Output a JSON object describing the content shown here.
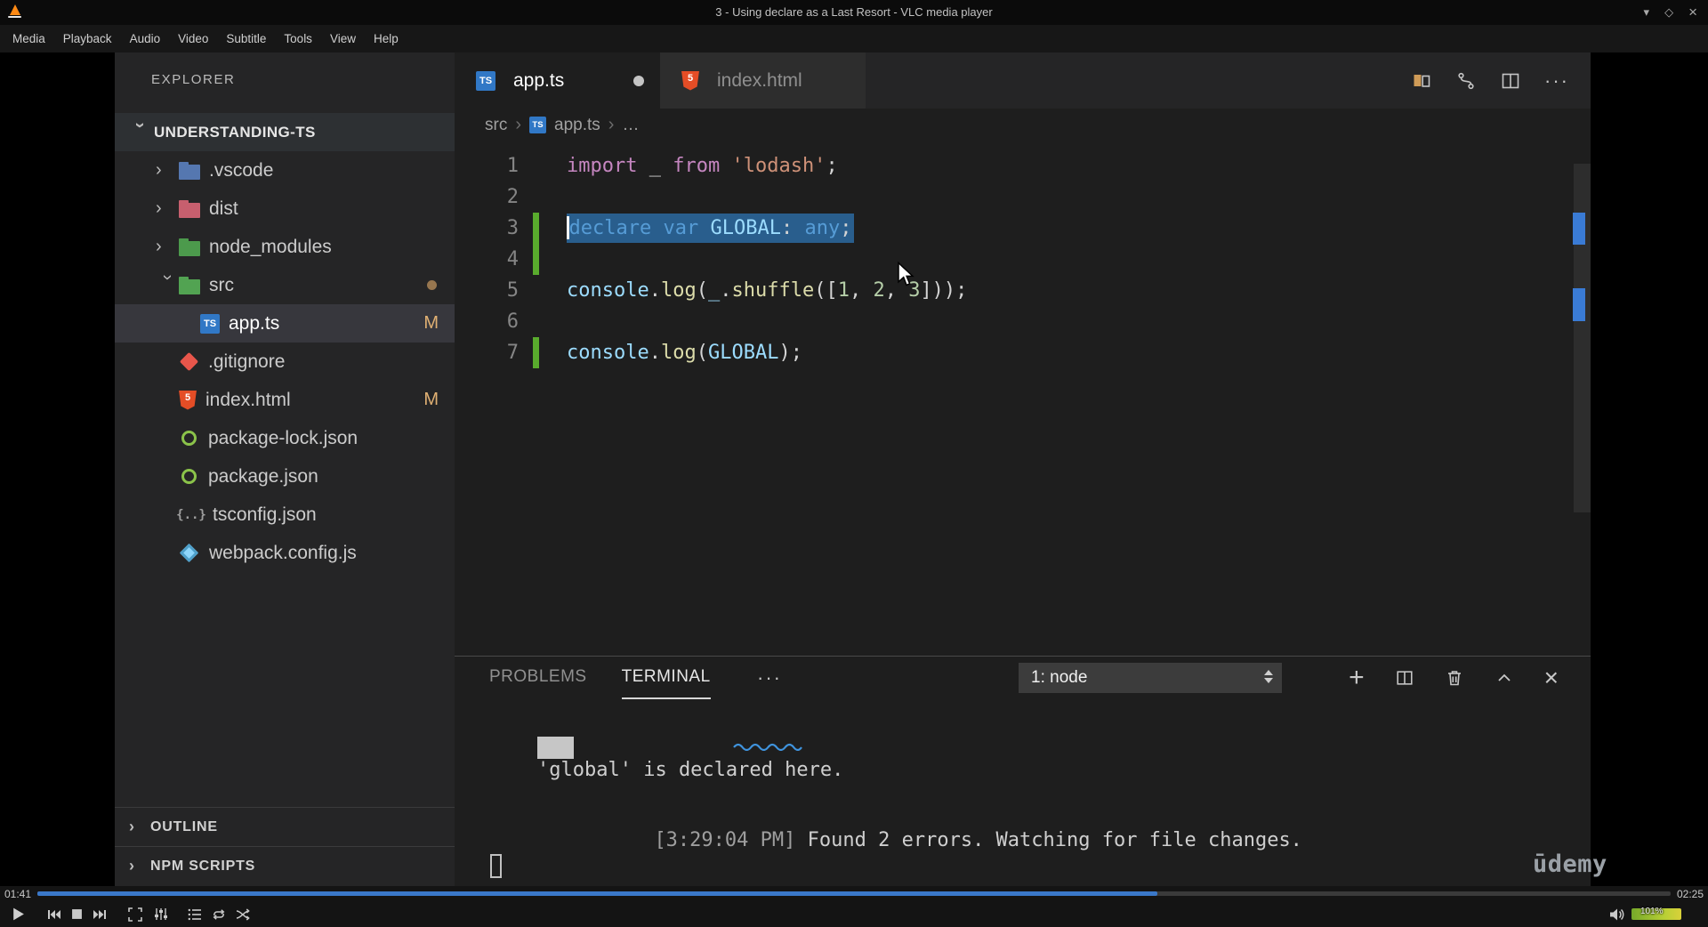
{
  "window": {
    "title": "3 - Using declare as a Last Resort - VLC media player",
    "menu_items": [
      "Media",
      "Playback",
      "Audio",
      "Video",
      "Subtitle",
      "Tools",
      "View",
      "Help"
    ]
  },
  "icons": {
    "minimize": "▾",
    "maximize": "◇",
    "close": "×",
    "chevron": "›",
    "ellipsis": "···",
    "plus": "+",
    "ts_badge": "TS",
    "html_badge": "5",
    "braces_glyph": "{..}"
  },
  "player": {
    "time_elapsed": "01:41",
    "time_total": "02:25",
    "progress_percent": 68.6,
    "volume_label": "101%"
  },
  "editor": {
    "explorer_title": "EXPLORER",
    "root_folder": "UNDERSTANDING-TS",
    "files": [
      {
        "label": ".vscode",
        "kind": "folder",
        "color": "#5577b0"
      },
      {
        "label": "dist",
        "kind": "folder",
        "color": "#c75f6e"
      },
      {
        "label": "node_modules",
        "kind": "folder",
        "color": "#4c9a4c"
      },
      {
        "label": "src",
        "kind": "folder",
        "color": "#52a352",
        "expand": true,
        "dot": true
      },
      {
        "label": "app.ts",
        "kind": "ts",
        "child": true,
        "selected": true,
        "badge": "M"
      },
      {
        "label": ".gitignore",
        "kind": "git"
      },
      {
        "label": "index.html",
        "kind": "html",
        "badge": "M"
      },
      {
        "label": "package-lock.json",
        "kind": "json"
      },
      {
        "label": "package.json",
        "kind": "json"
      },
      {
        "label": "tsconfig.json",
        "kind": "braces"
      },
      {
        "label": "webpack.config.js",
        "kind": "webpack"
      }
    ],
    "sections": [
      "OUTLINE",
      "NPM SCRIPTS"
    ],
    "tabs": [
      {
        "label": "app.ts",
        "icon": "ts",
        "active": true,
        "dirty": true
      },
      {
        "label": "index.html",
        "icon": "html",
        "active": false
      }
    ],
    "breadcrumb": [
      "src",
      "app.ts",
      "…"
    ],
    "code_lines": [
      {
        "n": "1",
        "tokens": [
          [
            "kw",
            "import"
          ],
          [
            "pl",
            " _ "
          ],
          [
            "kw",
            "from"
          ],
          [
            "pl",
            " "
          ],
          [
            "str",
            "'lodash'"
          ],
          [
            "pl",
            ";"
          ]
        ]
      },
      {
        "n": "2",
        "tokens": []
      },
      {
        "n": "3",
        "sel": true,
        "gutter": true,
        "tokens": [
          [
            "blue",
            "declare"
          ],
          [
            "pl",
            " "
          ],
          [
            "blue",
            "var"
          ],
          [
            "pl",
            " "
          ],
          [
            "id",
            "GLOBAL"
          ],
          [
            "pl",
            ": "
          ],
          [
            "blue",
            "any"
          ],
          [
            "pl",
            ";"
          ]
        ]
      },
      {
        "n": "4",
        "gutter": true,
        "tokens": []
      },
      {
        "n": "5",
        "tokens": [
          [
            "id",
            "console"
          ],
          [
            "pl",
            "."
          ],
          [
            "fn",
            "log"
          ],
          [
            "pl",
            "("
          ],
          [
            "id",
            "_"
          ],
          [
            "pl",
            "."
          ],
          [
            "fn",
            "shuffle"
          ],
          [
            "pl",
            "(["
          ],
          [
            "num",
            "1"
          ],
          [
            "pl",
            ", "
          ],
          [
            "num",
            "2"
          ],
          [
            "pl",
            ", "
          ],
          [
            "num",
            "3"
          ],
          [
            "pl",
            "]));"
          ]
        ]
      },
      {
        "n": "6",
        "tokens": []
      },
      {
        "n": "7",
        "gutter": true,
        "tokens": [
          [
            "id",
            "console"
          ],
          [
            "pl",
            "."
          ],
          [
            "fn",
            "log"
          ],
          [
            "pl",
            "("
          ],
          [
            "id",
            "GLOBAL"
          ],
          [
            "pl",
            ");"
          ]
        ]
      }
    ]
  },
  "terminal": {
    "tabs": [
      {
        "label": "PROBLEMS",
        "active": false
      },
      {
        "label": "TERMINAL",
        "active": true
      }
    ],
    "shell_selector": "1: node",
    "line1": "'global' is declared here.",
    "line2_time": "[3:29:04 PM]",
    "line2_text": " Found 2 errors. Watching for file changes.",
    "watermark": "ūdemy"
  }
}
